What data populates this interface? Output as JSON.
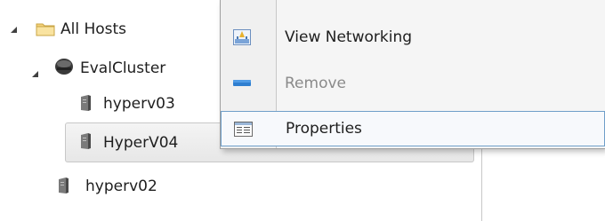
{
  "tree": {
    "items": [
      {
        "label": "All Hosts",
        "icon": "folder-icon",
        "expanded": true
      },
      {
        "label": "EvalCluster",
        "icon": "cluster-icon",
        "expanded": true
      },
      {
        "label": "hyperv03",
        "icon": "server-icon"
      },
      {
        "label": "HyperV04",
        "icon": "server-icon",
        "selected": true
      },
      {
        "label": "hyperv02",
        "icon": "server-icon"
      }
    ]
  },
  "context_menu": {
    "items": [
      {
        "label": "View Networking",
        "icon": "view-networking-icon",
        "enabled": true
      },
      {
        "label": "Remove",
        "icon": "remove-icon",
        "enabled": false
      },
      {
        "label": "Properties",
        "icon": "properties-icon",
        "enabled": true,
        "highlighted": true
      }
    ]
  },
  "colors": {
    "selection_border": "#c8c8c8",
    "menu_highlight_border": "#6f9fc9",
    "remove_icon": "#2f7fd0",
    "folder": "#f4d27a"
  }
}
